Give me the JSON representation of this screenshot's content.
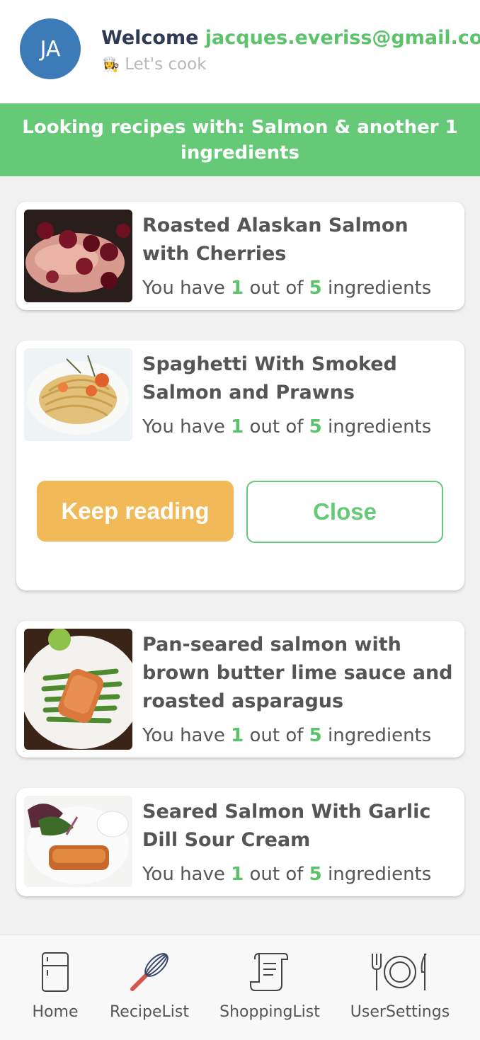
{
  "header": {
    "avatar_initials": "JA",
    "welcome_label": "Welcome",
    "email": "jacques.everiss@gmail.com",
    "subtitle_emoji": "👩‍🍳",
    "subtitle": "Let's cook"
  },
  "banner": {
    "text": "Looking recipes with: Salmon & another 1 ingredients"
  },
  "recipes": [
    {
      "title": "Roasted Alaskan Salmon with Cherries",
      "have_prefix": "You have",
      "have": "1",
      "out_of": "out of",
      "total": "5",
      "suffix": "ingredients"
    },
    {
      "title": "Spaghetti With Smoked Salmon and Prawns",
      "have_prefix": "You have",
      "have": "1",
      "out_of": "out of",
      "total": "5",
      "suffix": "ingredients"
    },
    {
      "title": "Pan-seared salmon with brown butter lime sauce and roasted asparagus",
      "have_prefix": "You have",
      "have": "1",
      "out_of": "out of",
      "total": "5",
      "suffix": "ingredients"
    },
    {
      "title": "Seared Salmon With Garlic Dill Sour Cream",
      "have_prefix": "You have",
      "have": "1",
      "out_of": "out of",
      "total": "5",
      "suffix": "ingredients"
    }
  ],
  "actions": {
    "keep_reading": "Keep reading",
    "close": "Close"
  },
  "tabs": [
    {
      "label": "Home",
      "icon": "fridge-icon"
    },
    {
      "label": "RecipeList",
      "icon": "whisk-icon"
    },
    {
      "label": "ShoppingList",
      "icon": "receipt-icon"
    },
    {
      "label": "UserSettings",
      "icon": "plate-cutlery-icon"
    }
  ],
  "colors": {
    "accent_green": "#66c978",
    "avatar_blue": "#3d7ab8",
    "keep_reading_orange": "#f2b959"
  }
}
